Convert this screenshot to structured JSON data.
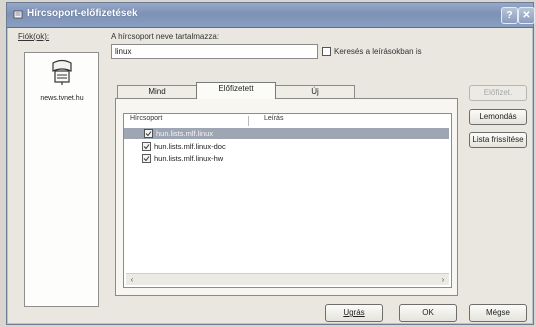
{
  "window": {
    "title": "Hírcsoport-előfizetések"
  },
  "accounts": {
    "label": "Fiók(ok):",
    "server": "news.tvnet.hu"
  },
  "search": {
    "label": "A hírcsoport neve tartalmazza:",
    "value": "linux",
    "checkbox_label": "Keresés a leírásokban is",
    "checked": false
  },
  "tabs": [
    {
      "label": "Mind"
    },
    {
      "label": "Előfizetett"
    },
    {
      "label": "Új"
    }
  ],
  "active_tab": "Előfizetett",
  "list": {
    "columns": [
      "Hírcsoport",
      "Leírás"
    ],
    "rows": [
      {
        "name": "hun.lists.mlf.linux",
        "selected": true
      },
      {
        "name": "hun.lists.mlf.linux-doc",
        "selected": false
      },
      {
        "name": "hun.lists.mlf.linux-hw",
        "selected": false
      }
    ]
  },
  "side_buttons": {
    "subscribe": "Előfizet.",
    "unsubscribe": "Lemondás",
    "reset": "Lista frissítése"
  },
  "footer": {
    "goto": "Ugrás",
    "ok": "OK",
    "cancel": "Mégse"
  },
  "colors": {
    "titlebar": "#8a9ec2",
    "selection": "#9ea6b4"
  }
}
